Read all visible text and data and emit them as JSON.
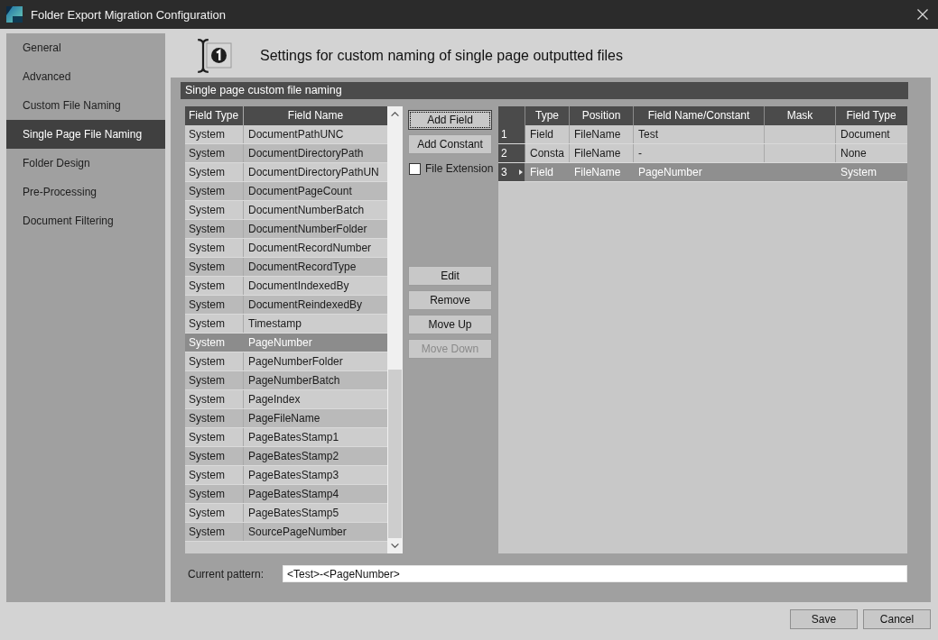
{
  "window": {
    "title": "Folder Export Migration Configuration"
  },
  "sidebar": {
    "items": [
      {
        "label": "General",
        "selected": false
      },
      {
        "label": "Advanced",
        "selected": false
      },
      {
        "label": "Custom File Naming",
        "selected": false
      },
      {
        "label": "Single Page File Naming",
        "selected": true
      },
      {
        "label": "Folder Design",
        "selected": false
      },
      {
        "label": "Pre-Processing",
        "selected": false
      },
      {
        "label": "Document Filtering",
        "selected": false
      }
    ]
  },
  "header": {
    "title": "Settings for custom naming of single page outputted files"
  },
  "section": {
    "title": "Single page custom file naming"
  },
  "fields_table": {
    "columns": [
      "Field Type",
      "Field Name"
    ],
    "rows": [
      {
        "cells": [
          "System",
          "DocumentPathUNC"
        ],
        "selected": false
      },
      {
        "cells": [
          "System",
          "DocumentDirectoryPath"
        ],
        "selected": false
      },
      {
        "cells": [
          "System",
          "DocumentDirectoryPathUN"
        ],
        "selected": false
      },
      {
        "cells": [
          "System",
          "DocumentPageCount"
        ],
        "selected": false
      },
      {
        "cells": [
          "System",
          "DocumentNumberBatch"
        ],
        "selected": false
      },
      {
        "cells": [
          "System",
          "DocumentNumberFolder"
        ],
        "selected": false
      },
      {
        "cells": [
          "System",
          "DocumentRecordNumber"
        ],
        "selected": false
      },
      {
        "cells": [
          "System",
          "DocumentRecordType"
        ],
        "selected": false
      },
      {
        "cells": [
          "System",
          "DocumentIndexedBy"
        ],
        "selected": false
      },
      {
        "cells": [
          "System",
          "DocumentReindexedBy"
        ],
        "selected": false
      },
      {
        "cells": [
          "System",
          "Timestamp"
        ],
        "selected": false
      },
      {
        "cells": [
          "System",
          "PageNumber"
        ],
        "selected": true
      },
      {
        "cells": [
          "System",
          "PageNumberFolder"
        ],
        "selected": false
      },
      {
        "cells": [
          "System",
          "PageNumberBatch"
        ],
        "selected": false
      },
      {
        "cells": [
          "System",
          "PageIndex"
        ],
        "selected": false
      },
      {
        "cells": [
          "System",
          "PageFileName"
        ],
        "selected": false
      },
      {
        "cells": [
          "System",
          "PageBatesStamp1"
        ],
        "selected": false
      },
      {
        "cells": [
          "System",
          "PageBatesStamp2"
        ],
        "selected": false
      },
      {
        "cells": [
          "System",
          "PageBatesStamp3"
        ],
        "selected": false
      },
      {
        "cells": [
          "System",
          "PageBatesStamp4"
        ],
        "selected": false
      },
      {
        "cells": [
          "System",
          "PageBatesStamp5"
        ],
        "selected": false
      },
      {
        "cells": [
          "System",
          "SourcePageNumber"
        ],
        "selected": false
      }
    ]
  },
  "add_buttons": [
    {
      "label": "Add Field",
      "focused": true,
      "disabled": false
    },
    {
      "label": "Add Constant",
      "focused": false,
      "disabled": false
    }
  ],
  "file_extension": {
    "label": "File Extension",
    "checked": false
  },
  "edit_buttons": [
    {
      "label": "Edit",
      "focused": false,
      "disabled": false
    },
    {
      "label": "Remove",
      "focused": false,
      "disabled": false
    },
    {
      "label": "Move Up",
      "focused": false,
      "disabled": false
    },
    {
      "label": "Move Down",
      "focused": false,
      "disabled": true
    }
  ],
  "naming_table": {
    "columns": [
      "Type",
      "Position",
      "Field Name/Constant",
      "Mask",
      "Field Type"
    ],
    "rows": [
      {
        "number": "1",
        "type": "Field",
        "position": "FileName",
        "field_name": "Test",
        "field_type": "Document",
        "selected": false
      },
      {
        "number": "2",
        "type": "Consta",
        "position": "FileName",
        "field_name": "-",
        "field_type": "None",
        "selected": false
      },
      {
        "number": "3",
        "type": "Field",
        "position": "FileName",
        "field_name": "PageNumber",
        "field_type": "System",
        "selected": true
      }
    ]
  },
  "pattern": {
    "label": "Current pattern:",
    "value": "<Test>-<PageNumber>"
  },
  "footer_buttons": [
    {
      "label": "Save"
    },
    {
      "label": "Cancel"
    }
  ]
}
